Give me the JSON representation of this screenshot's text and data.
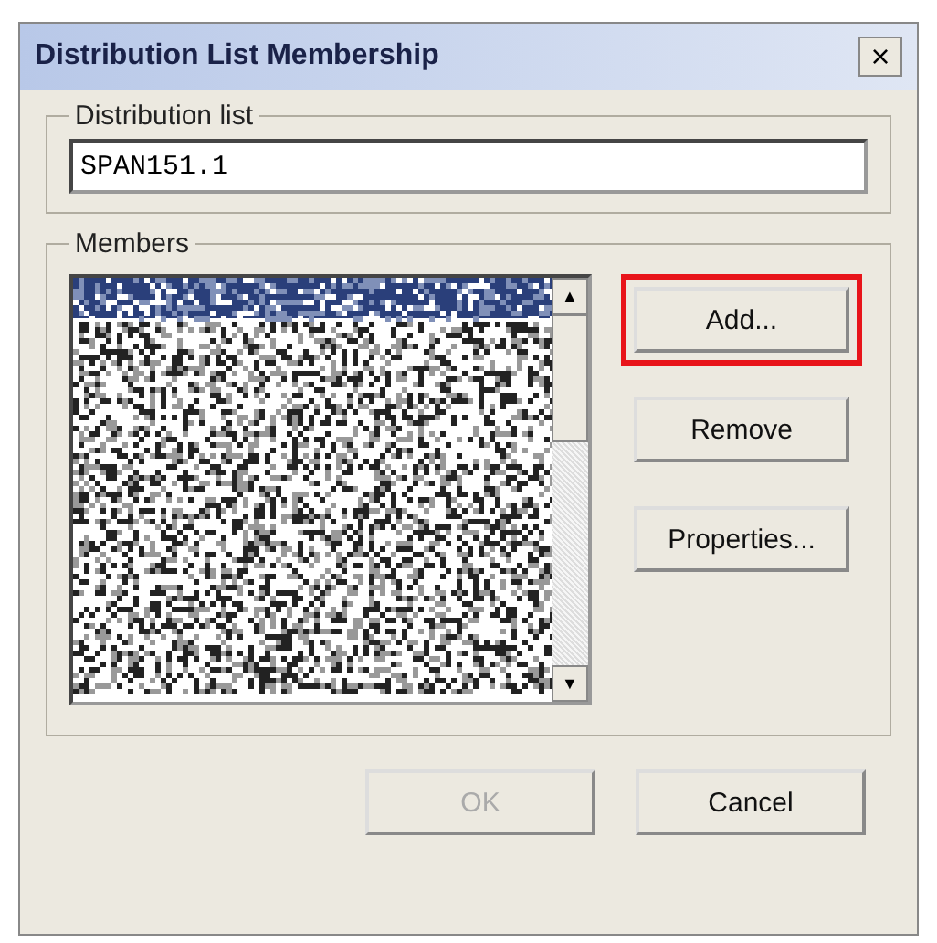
{
  "window": {
    "title": "Distribution List Membership",
    "close": "×"
  },
  "distribution_list": {
    "label": "Distribution list",
    "value": "SPAN151.1"
  },
  "members": {
    "label": "Members",
    "list": {
      "selected_first": true,
      "scroll_up": "▲",
      "scroll_down": "▼"
    },
    "buttons": [
      {
        "label": "Add...",
        "highlighted": true,
        "disabled": false
      },
      {
        "label": "Remove",
        "highlighted": false,
        "disabled": false
      },
      {
        "label": "Properties...",
        "highlighted": false,
        "disabled": false
      }
    ]
  },
  "footer_buttons": [
    {
      "label": "OK",
      "disabled": true
    },
    {
      "label": "Cancel",
      "disabled": false
    }
  ]
}
